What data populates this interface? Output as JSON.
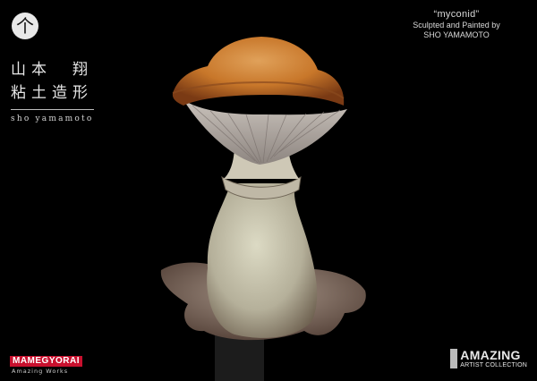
{
  "logo": {
    "glyph": "个",
    "icon": "umbrella-kanji-logo-icon"
  },
  "artist": {
    "name_line1": "山本　翔",
    "name_line2": "粘土造形",
    "romaji": "sho yamamoto"
  },
  "credits": {
    "title": "“myconid”",
    "line1": "Sculpted and Painted by",
    "line2": "SHO YAMAMOTO"
  },
  "brand": {
    "main": "MAMEGYORAI",
    "sub": "Amazing Works"
  },
  "collection": {
    "big": "AMAZING",
    "small": "ARTIST COLLECTION"
  },
  "colors": {
    "background": "#000000",
    "cap": "#c8772a",
    "stem": "#cfcbb3",
    "brand_red": "#c8102e"
  }
}
